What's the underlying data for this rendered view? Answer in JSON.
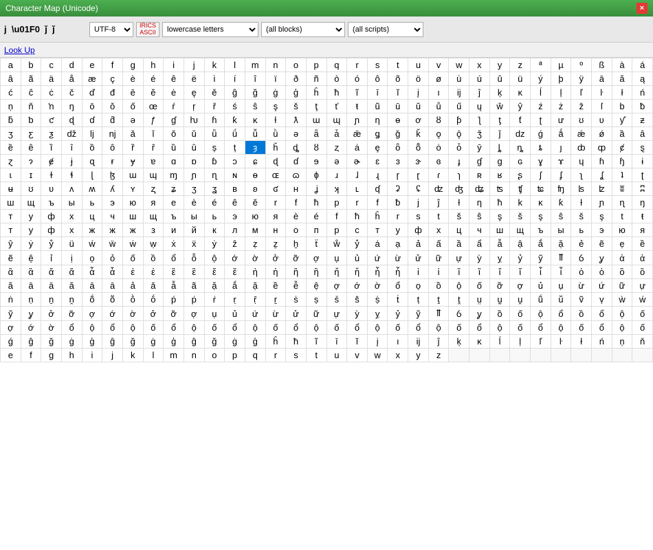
{
  "titleBar": {
    "title": "Character Map (Unicode)",
    "closeLabel": "×"
  },
  "toolbar": {
    "charInfo": "j  \\u01F0  &#496;  &#x1F0;",
    "encoding": "UTF-8",
    "iriicsLabel": "IRICS\nASCII",
    "category": "lowercase letters",
    "block": "(all blocks)",
    "script": "(all scripts)"
  },
  "lookupBar": {
    "label": "Look Up"
  },
  "grid": {
    "selectedChar": "ǰ",
    "selectedIndex": [
      4,
      9
    ]
  }
}
